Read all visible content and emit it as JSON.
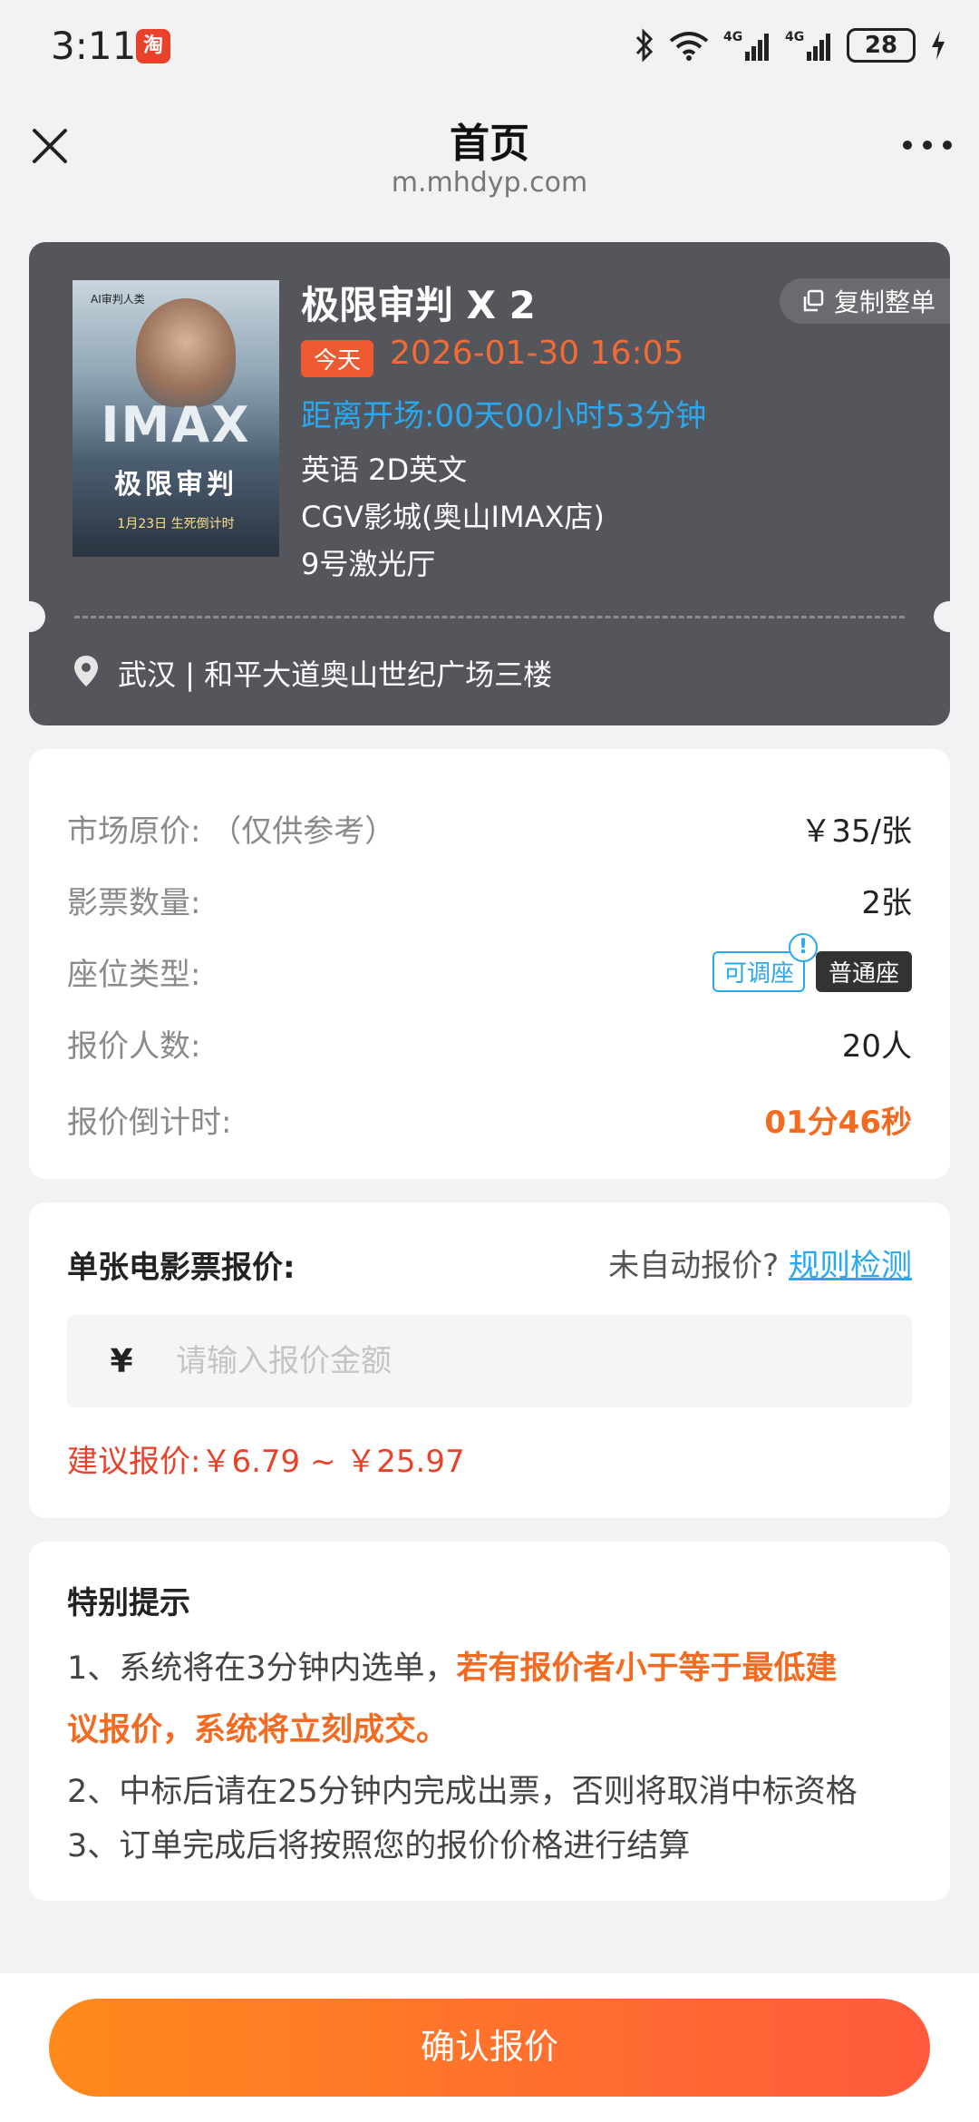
{
  "status_bar": {
    "time": "3:11",
    "app_icon_glyph": "淘",
    "battery": "28"
  },
  "nav": {
    "title": "首页",
    "url": "m.mhdyp.com"
  },
  "ticket": {
    "poster": {
      "top_text": "AI审判人类",
      "imax": "IMAX",
      "title": "极限审判",
      "date": "1月23日 生死倒计时"
    },
    "title": "极限审判  X 2",
    "copy_label": "复制整单",
    "today_badge": "今天",
    "showtime": "2026-01-30 16:05",
    "countdown": "距离开场:00天00小时53分钟",
    "language": "英语 2D英文",
    "cinema": "CGV影城(奥山IMAX店)",
    "hall": "9号激光厅",
    "address": "武汉 | 和平大道奥山世纪广场三楼"
  },
  "info": {
    "market_price_label": "市场原价:  （仅供参考）",
    "market_price_value": "￥35/张",
    "ticket_count_label": "影票数量:",
    "ticket_count_value": "2张",
    "seat_type_label": "座位类型:",
    "seat_adjustable": "可调座",
    "seat_alert": "!",
    "seat_type": "普通座",
    "bidder_count_label": "报价人数:",
    "bidder_count_value": "20人",
    "quote_countdown_label": "报价倒计时:",
    "quote_countdown_value": "01分46秒"
  },
  "quote": {
    "title": "单张电影票报价:",
    "hint": "未自动报价?",
    "rule_link": "规则检测",
    "currency": "¥",
    "placeholder": "请输入报价金额",
    "suggest": "建议报价:￥6.79 ~ ￥25.97"
  },
  "notice": {
    "title": "特别提示",
    "line1_prefix": "1、系统将在3分钟内选单，",
    "line1_highlight": "若有报价者小于等于最低建",
    "line1_highlight_2": "议报价，系统将立刻成交。",
    "line2": "2、中标后请在25分钟内完成出票，否则将取消中标资格",
    "line3": "3、订单完成后将按照您的报价价格进行结算"
  },
  "footer": {
    "confirm": "确认报价"
  },
  "colors": {
    "accent_orange": "#f26b21",
    "accent_blue": "#29a8ef",
    "warning_red": "#e8432a",
    "ticket_bg": "#54565b"
  }
}
